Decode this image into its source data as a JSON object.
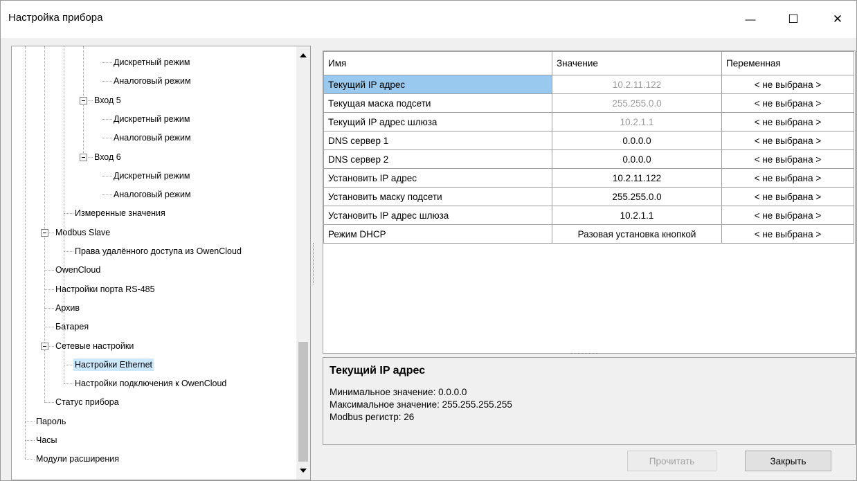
{
  "window": {
    "title": "Настройка прибора",
    "minimize": "—",
    "maximize": "☐",
    "close": "✕"
  },
  "tree": [
    {
      "label": "Дискретный режим",
      "level": 4,
      "expander": false,
      "selected": false
    },
    {
      "label": "Аналоговый режим",
      "level": 4,
      "expander": false,
      "selected": false
    },
    {
      "label": "Вход 5",
      "level": 3,
      "expander": true,
      "selected": false
    },
    {
      "label": "Дискретный режим",
      "level": 4,
      "expander": false,
      "selected": false
    },
    {
      "label": "Аналоговый режим",
      "level": 4,
      "expander": false,
      "selected": false
    },
    {
      "label": "Вход 6",
      "level": 3,
      "expander": true,
      "selected": false
    },
    {
      "label": "Дискретный режим",
      "level": 4,
      "expander": false,
      "selected": false
    },
    {
      "label": "Аналоговый режим",
      "level": 4,
      "expander": false,
      "selected": false
    },
    {
      "label": "Измеренные значения",
      "level": 2,
      "expander": false,
      "selected": false
    },
    {
      "label": "Modbus Slave",
      "level": 1,
      "expander": true,
      "selected": false
    },
    {
      "label": "Права удалённого доступа из OwenCloud",
      "level": 2,
      "expander": false,
      "selected": false
    },
    {
      "label": "OwenCloud",
      "level": 1,
      "expander": false,
      "selected": false
    },
    {
      "label": "Настройки порта RS-485",
      "level": 1,
      "expander": false,
      "selected": false
    },
    {
      "label": "Архив",
      "level": 1,
      "expander": false,
      "selected": false
    },
    {
      "label": "Батарея",
      "level": 1,
      "expander": false,
      "selected": false
    },
    {
      "label": "Сетевые настройки",
      "level": 1,
      "expander": true,
      "selected": false
    },
    {
      "label": "Настройки Ethernet",
      "level": 2,
      "expander": false,
      "selected": true
    },
    {
      "label": "Настройки подключения к OwenCloud",
      "level": 2,
      "expander": false,
      "selected": false
    },
    {
      "label": "Статус прибора",
      "level": 1,
      "expander": false,
      "selected": false
    },
    {
      "label": "Пароль",
      "level": 0,
      "expander": false,
      "selected": false
    },
    {
      "label": "Часы",
      "level": 0,
      "expander": false,
      "selected": false
    },
    {
      "label": "Модули расширения",
      "level": 0,
      "expander": false,
      "selected": false
    }
  ],
  "grid": {
    "headers": {
      "name": "Имя",
      "value": "Значение",
      "variable": "Переменная"
    },
    "rows": [
      {
        "name": "Текущий IP адрес",
        "value": "10.2.11.122",
        "variable": "< не выбрана >",
        "readonly": true,
        "selected": true
      },
      {
        "name": "Текущая маска подсети",
        "value": "255.255.0.0",
        "variable": "< не выбрана >",
        "readonly": true,
        "selected": false
      },
      {
        "name": "Текущий IP адрес шлюза",
        "value": "10.2.1.1",
        "variable": "< не выбрана >",
        "readonly": true,
        "selected": false
      },
      {
        "name": "DNS сервер 1",
        "value": "0.0.0.0",
        "variable": "< не выбрана >",
        "readonly": false,
        "selected": false
      },
      {
        "name": "DNS сервер 2",
        "value": "0.0.0.0",
        "variable": "< не выбрана >",
        "readonly": false,
        "selected": false
      },
      {
        "name": "Установить IP адрес",
        "value": "10.2.11.122",
        "variable": "< не выбрана >",
        "readonly": false,
        "selected": false
      },
      {
        "name": "Установить маску подсети",
        "value": "255.255.0.0",
        "variable": "< не выбрана >",
        "readonly": false,
        "selected": false
      },
      {
        "name": "Установить IP адрес шлюза",
        "value": "10.2.1.1",
        "variable": "< не выбрана >",
        "readonly": false,
        "selected": false
      },
      {
        "name": "Режим DHCP",
        "value": "Разовая установка кнопкой",
        "variable": "< не выбрана >",
        "readonly": false,
        "selected": false
      }
    ]
  },
  "description": {
    "title": "Текущий IP адрес",
    "min": "Минимальное значение: 0.0.0.0",
    "max": "Максимальное значение: 255.255.255.255",
    "register": "Modbus регистр: 26"
  },
  "buttons": {
    "read": "Прочитать",
    "close": "Закрыть"
  },
  "colors": {
    "selection": "#cce8ff",
    "grid_selection": "#99c9ef"
  }
}
